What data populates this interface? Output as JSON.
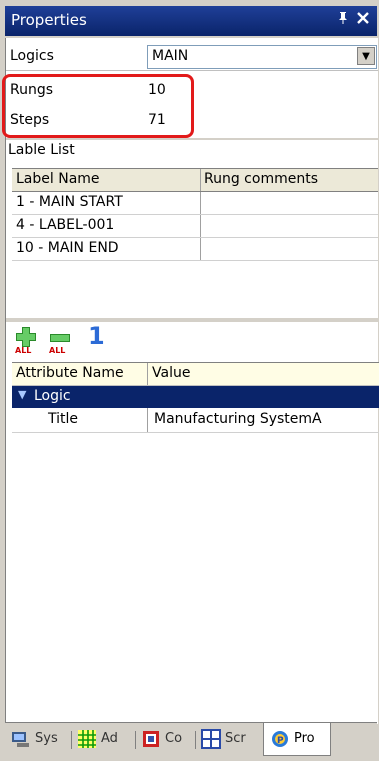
{
  "window": {
    "title": "Properties",
    "pin_glyph": "I",
    "close_glyph": "×"
  },
  "top_properties": {
    "logics_label": "Logics",
    "logics_value": "MAIN",
    "rungs_label": "Rungs",
    "rungs_value": "10",
    "steps_label": "Steps",
    "steps_value": "71"
  },
  "label_list": {
    "caption": "Lable List",
    "columns": [
      "Label Name",
      "Rung comments"
    ],
    "rows": [
      {
        "name": "1 - MAIN START",
        "comment": ""
      },
      {
        "name": "4 - LABEL-001",
        "comment": ""
      },
      {
        "name": "10 - MAIN END",
        "comment": ""
      }
    ]
  },
  "toolbar": {
    "icons": [
      "add-all-icon",
      "remove-all-icon",
      "one-icon"
    ],
    "one_glyph": "1"
  },
  "attributes": {
    "columns": [
      "Attribute Name",
      "Value"
    ],
    "group": "Logic",
    "rows": [
      {
        "name": "Title",
        "value": "Manufacturing SystemA"
      }
    ]
  },
  "bottom_tabs": [
    {
      "label": "Sys",
      "icon": "system-icon"
    },
    {
      "label": "Ad",
      "icon": "address-grid-icon"
    },
    {
      "label": "Co",
      "icon": "comment-icon"
    },
    {
      "label": "Scr",
      "icon": "screen-icon"
    },
    {
      "label": "Pro",
      "icon": "properties-icon",
      "active": true
    }
  ],
  "colors": {
    "titlebar": "#0a246a",
    "highlight": "#e21a1a",
    "group_row": "#0a246a",
    "header_bg": "#fffde5"
  }
}
